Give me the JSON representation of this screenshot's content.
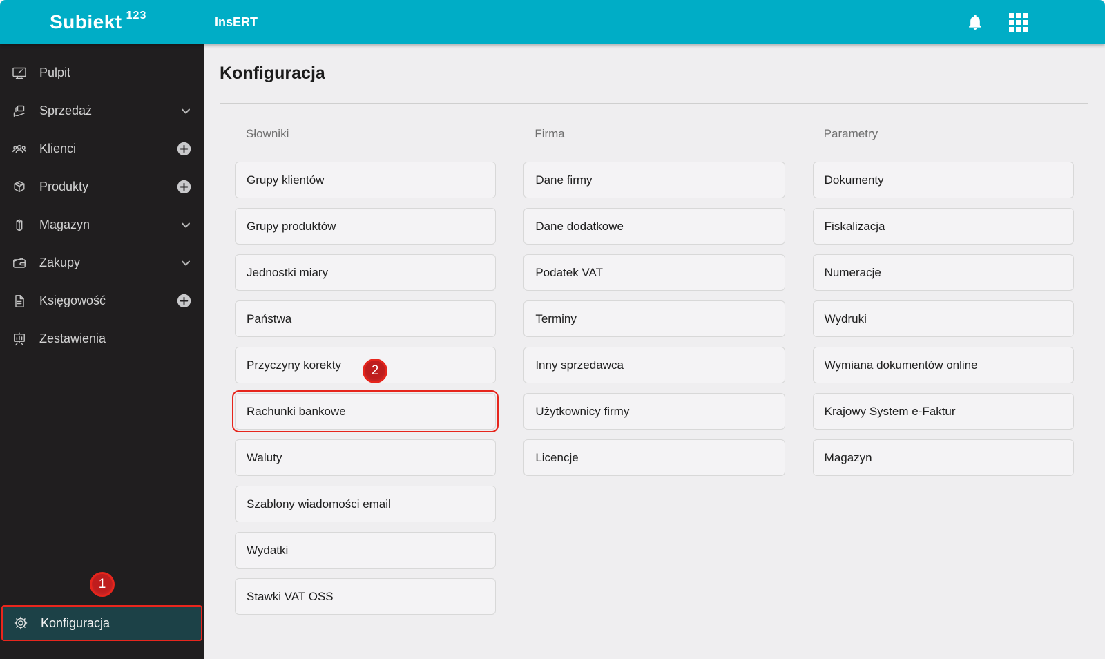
{
  "topbar": {
    "logo_brand": "Subiekt",
    "logo_sup": "123",
    "product": "InsERT",
    "icons": [
      "bell-icon",
      "apps-grid-icon"
    ]
  },
  "sidebar": {
    "items": [
      {
        "label": "Pulpit",
        "icon": "desktop",
        "accessory": "none"
      },
      {
        "label": "Sprzedaż",
        "icon": "sales",
        "accessory": "chevron"
      },
      {
        "label": "Klienci",
        "icon": "clients",
        "accessory": "plus"
      },
      {
        "label": "Produkty",
        "icon": "products",
        "accessory": "plus"
      },
      {
        "label": "Magazyn",
        "icon": "warehouse",
        "accessory": "chevron"
      },
      {
        "label": "Zakupy",
        "icon": "purchases",
        "accessory": "chevron"
      },
      {
        "label": "Księgowość",
        "icon": "accounting",
        "accessory": "plus"
      },
      {
        "label": "Zestawienia",
        "icon": "reports",
        "accessory": "none"
      }
    ],
    "bottom_item": {
      "label": "Konfiguracja",
      "icon": "gear",
      "selected": true
    }
  },
  "annotations": {
    "step1": "1",
    "step2": "2"
  },
  "main": {
    "title": "Konfiguracja",
    "columns": [
      {
        "header": "Słowniki",
        "items": [
          {
            "label": "Grupy klientów"
          },
          {
            "label": "Grupy produktów"
          },
          {
            "label": "Jednostki miary"
          },
          {
            "label": "Państwa"
          },
          {
            "label": "Przyczyny korekty",
            "badge": "2"
          },
          {
            "label": "Rachunki bankowe",
            "highlighted": true
          },
          {
            "label": "Waluty"
          },
          {
            "label": "Szablony wiadomości email"
          },
          {
            "label": "Wydatki"
          },
          {
            "label": "Stawki VAT OSS"
          }
        ]
      },
      {
        "header": "Firma",
        "items": [
          {
            "label": "Dane firmy"
          },
          {
            "label": "Dane dodatkowe"
          },
          {
            "label": "Podatek VAT"
          },
          {
            "label": "Terminy"
          },
          {
            "label": "Inny sprzedawca"
          },
          {
            "label": "Użytkownicy firmy"
          },
          {
            "label": "Licencje"
          }
        ]
      },
      {
        "header": "Parametry",
        "items": [
          {
            "label": "Dokumenty"
          },
          {
            "label": "Fiskalizacja"
          },
          {
            "label": "Numeracje"
          },
          {
            "label": "Wydruki"
          },
          {
            "label": "Wymiana dokumentów online"
          },
          {
            "label": "Krajowy System e-Faktur"
          },
          {
            "label": "Magazyn"
          }
        ]
      }
    ]
  },
  "colors": {
    "accent_teal": "#00adc6",
    "sidebar_bg": "#201e1f",
    "selected_item_bg": "#1c4147",
    "annotation_red": "#e6251c",
    "content_bg": "#efeef0",
    "card_bg": "#f4f3f5"
  }
}
